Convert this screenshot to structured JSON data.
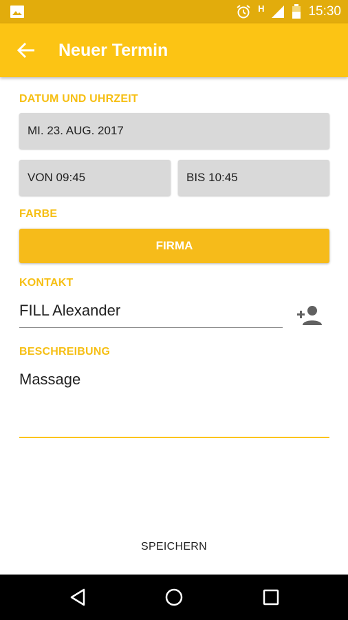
{
  "status_bar": {
    "time": "15:30",
    "indicator": "H",
    "icons": [
      "gallery-icon",
      "alarm-icon",
      "signal-icon",
      "battery-icon"
    ]
  },
  "app_bar": {
    "title": "Neuer Termin",
    "back_icon": "arrow-back-icon",
    "color": "#fcc414"
  },
  "form": {
    "date_time": {
      "label": "DATUM UND UHRZEIT",
      "date": "MI. 23. AUG. 2017",
      "from": "VON 09:45",
      "to": "BIS 10:45"
    },
    "color": {
      "label": "FARBE",
      "value": "FIRMA",
      "color": "#f6bb1a"
    },
    "contact": {
      "label": "KONTAKT",
      "value": "FILL Alexander",
      "add_icon": "person-add-icon"
    },
    "description": {
      "label": "BESCHREIBUNG",
      "value": "Massage"
    }
  },
  "actions": {
    "save_label": "SPEICHERN"
  },
  "nav_bar": {
    "icons": [
      "back-triangle-icon",
      "home-circle-icon",
      "recents-square-icon"
    ]
  },
  "colors": {
    "accent": "#fcc414",
    "status_bar": "#e2ac0c",
    "label": "#f6bf14"
  }
}
